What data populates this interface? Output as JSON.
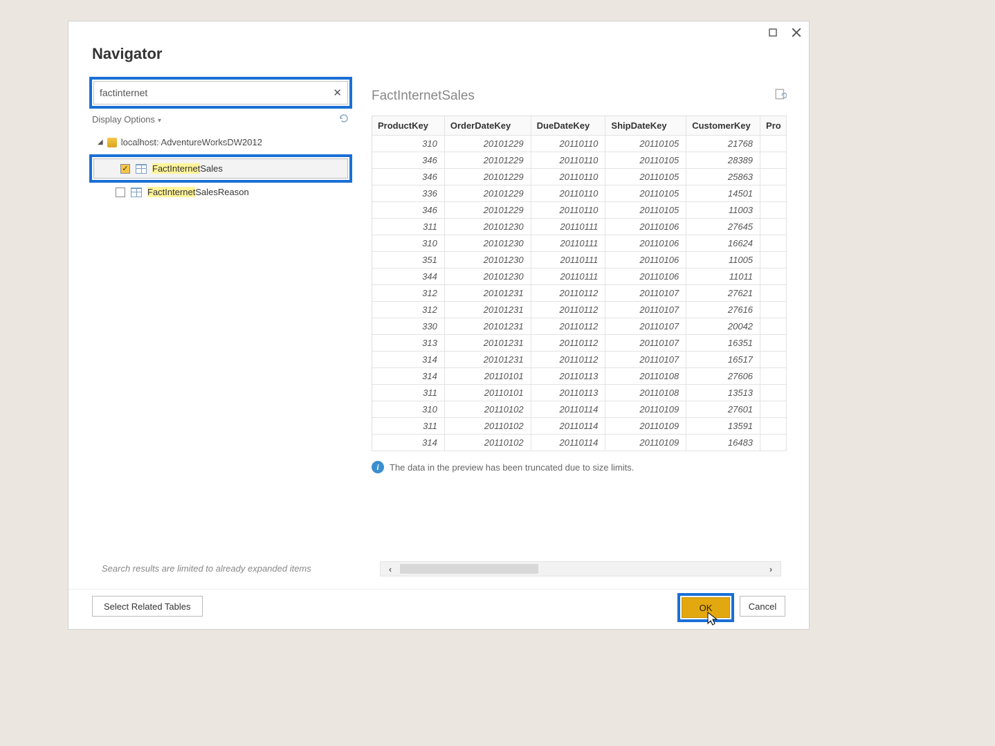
{
  "dialog": {
    "title": "Navigator",
    "search_value": "factinternet",
    "display_options_label": "Display Options",
    "database_label": "localhost: AdventureWorksDW2012",
    "tables": [
      {
        "match": "FactInternet",
        "rest": "Sales",
        "checked": true,
        "selected": true
      },
      {
        "match": "FactInternet",
        "rest": "SalesReason",
        "checked": false,
        "selected": false
      }
    ],
    "search_note": "Search results are limited to already expanded items"
  },
  "preview": {
    "title": "FactInternetSales",
    "columns": [
      "ProductKey",
      "OrderDateKey",
      "DueDateKey",
      "ShipDateKey",
      "CustomerKey",
      "Pro"
    ],
    "rows": [
      [
        310,
        20101229,
        20110110,
        20110105,
        21768
      ],
      [
        346,
        20101229,
        20110110,
        20110105,
        28389
      ],
      [
        346,
        20101229,
        20110110,
        20110105,
        25863
      ],
      [
        336,
        20101229,
        20110110,
        20110105,
        14501
      ],
      [
        346,
        20101229,
        20110110,
        20110105,
        11003
      ],
      [
        311,
        20101230,
        20110111,
        20110106,
        27645
      ],
      [
        310,
        20101230,
        20110111,
        20110106,
        16624
      ],
      [
        351,
        20101230,
        20110111,
        20110106,
        11005
      ],
      [
        344,
        20101230,
        20110111,
        20110106,
        11011
      ],
      [
        312,
        20101231,
        20110112,
        20110107,
        27621
      ],
      [
        312,
        20101231,
        20110112,
        20110107,
        27616
      ],
      [
        330,
        20101231,
        20110112,
        20110107,
        20042
      ],
      [
        313,
        20101231,
        20110112,
        20110107,
        16351
      ],
      [
        314,
        20101231,
        20110112,
        20110107,
        16517
      ],
      [
        314,
        20110101,
        20110113,
        20110108,
        27606
      ],
      [
        311,
        20110101,
        20110113,
        20110108,
        13513
      ],
      [
        310,
        20110102,
        20110114,
        20110109,
        27601
      ],
      [
        311,
        20110102,
        20110114,
        20110109,
        13591
      ],
      [
        314,
        20110102,
        20110114,
        20110109,
        16483
      ]
    ],
    "info": "The data in the preview has been truncated due to size limits."
  },
  "buttons": {
    "select_related": "Select Related Tables",
    "ok": "OK",
    "cancel": "Cancel"
  }
}
